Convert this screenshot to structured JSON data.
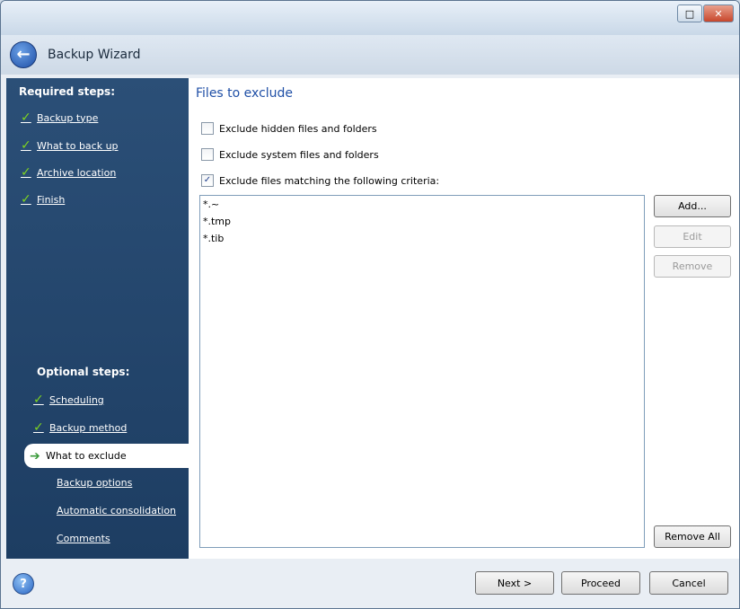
{
  "window": {
    "title": "Backup Wizard",
    "controls": {
      "restore_icon": "restore-icon",
      "close_symbol": "✕"
    }
  },
  "sidebar": {
    "required_header": "Required steps:",
    "required_items": [
      {
        "label": "Backup type",
        "done": true
      },
      {
        "label": "What to back up",
        "done": true
      },
      {
        "label": "Archive location",
        "done": true
      },
      {
        "label": "Finish",
        "done": true
      }
    ],
    "optional_header": "Optional steps:",
    "optional_items": [
      {
        "label": "Scheduling",
        "done": true
      },
      {
        "label": "Backup method",
        "done": true
      },
      {
        "label": "What to exclude",
        "current": true
      },
      {
        "label": "Backup options"
      },
      {
        "label": "Automatic consolidation"
      },
      {
        "label": "Comments"
      }
    ]
  },
  "main": {
    "title": "Files to exclude",
    "checkboxes": [
      {
        "label": "Exclude hidden files and folders",
        "checked": false
      },
      {
        "label": "Exclude system files and folders",
        "checked": false
      },
      {
        "label": "Exclude files matching the following criteria:",
        "checked": true
      }
    ],
    "criteria": [
      "*.~",
      "*.tmp",
      "*.tib"
    ],
    "buttons": {
      "add": "Add...",
      "edit": "Edit",
      "remove": "Remove",
      "remove_all": "Remove All"
    }
  },
  "footer": {
    "next": "Next >",
    "proceed": "Proceed",
    "cancel": "Cancel"
  },
  "colors": {
    "sidebar": "#1d3d62",
    "title_blue": "#1f4fa6",
    "check_green": "#7ed321"
  }
}
